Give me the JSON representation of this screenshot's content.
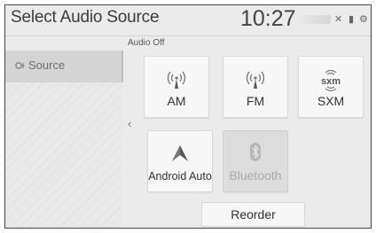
{
  "header": {
    "title": "Select Audio Source",
    "clock": "10:27"
  },
  "status_text": "Audio Off",
  "sidebar": {
    "items": [
      {
        "label": "Source"
      }
    ]
  },
  "sources": [
    {
      "label": "AM",
      "icon": "radio-wave-icon",
      "enabled": true
    },
    {
      "label": "FM",
      "icon": "radio-wave-icon",
      "enabled": true
    },
    {
      "label": "SXM",
      "icon": "sxm-logo-icon",
      "logo_text": "sxm",
      "enabled": true
    },
    {
      "label": "Android Auto",
      "icon": "android-auto-icon",
      "enabled": true
    },
    {
      "label": "Bluetooth",
      "icon": "bluetooth-icon",
      "enabled": false
    }
  ],
  "reorder_label": "Reorder"
}
